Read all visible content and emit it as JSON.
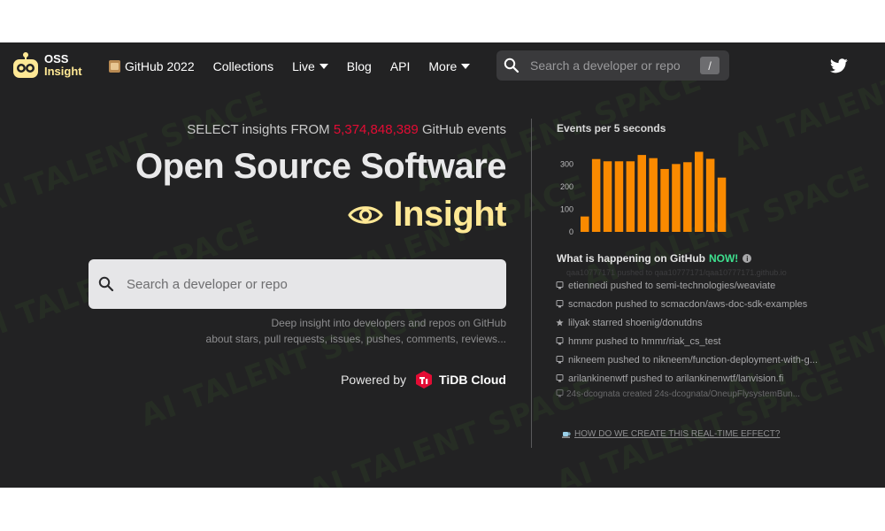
{
  "logo": {
    "line1": "OSS",
    "line2": "Insight"
  },
  "nav": {
    "items": [
      {
        "label": "GitHub 2022",
        "icon": "book-icon"
      },
      {
        "label": "Collections"
      },
      {
        "label": "Live",
        "dropdown": true
      },
      {
        "label": "Blog"
      },
      {
        "label": "API"
      },
      {
        "label": "More",
        "dropdown": true
      }
    ],
    "search_placeholder": "Search a developer or repo",
    "search_key": "/",
    "social_icon": "twitter-icon"
  },
  "hero": {
    "select_prefix": "SELECT insights FROM",
    "event_count": "5,374,848,389",
    "select_suffix": "GitHub events",
    "title": "Open Source Software",
    "insight": "Insight",
    "search_placeholder": "Search a developer or repo",
    "deep_line1": "Deep insight into developers and repos on GitHub",
    "deep_line2": "about stars, pull requests, issues, pushes, comments, reviews...",
    "powered_by": "Powered by",
    "brand": "TiDB Cloud"
  },
  "events_chart": {
    "title": "Events per 5 seconds",
    "chart_data": {
      "type": "bar",
      "y_ticks": [
        "300",
        "200",
        "100",
        "0"
      ],
      "ylim": [
        0,
        360
      ],
      "values": [
        68,
        322,
        312,
        312,
        312,
        340,
        326,
        278,
        300,
        308,
        354,
        323,
        240
      ],
      "bar_color": "#fa8a00"
    }
  },
  "happening": {
    "label": "What is happening on GitHub",
    "now": "NOW!",
    "info": "i"
  },
  "feed": [
    {
      "text": "etiennedi pushed to semi-technologies/weaviate",
      "icon": "push-icon"
    },
    {
      "text": "scmacdon pushed to scmacdon/aws-doc-sdk-examples",
      "icon": "push-icon"
    },
    {
      "text": "lilyak starred shoenig/donutdns",
      "icon": "star-icon"
    },
    {
      "text": "hmmr pushed to hmmr/riak_cs_test",
      "icon": "push-icon"
    },
    {
      "text": "nikneem pushed to nikneem/function-deployment-with-g...",
      "icon": "push-icon"
    },
    {
      "text": "arilankinenwtf pushed to arilankinenwtf/lanvision.fi",
      "icon": "push-icon"
    }
  ],
  "feed_faded_top": "qaa10777171 pushed to qaa10777171/qaa10777171.github.io",
  "feed_faded_bottom": "24s-dcognata created 24s-dcognata/OneupFlysystemBun...",
  "how_link": "HOW DO WE CREATE THIS REAL-TIME EFFECT?",
  "watermark": "AI TALENT SPACE",
  "colors": {
    "accent_yellow": "#ffe895",
    "event_red": "#e30c34",
    "now_green": "#3ee08f",
    "bar_orange": "#fa8a00",
    "bg": "#222223"
  }
}
